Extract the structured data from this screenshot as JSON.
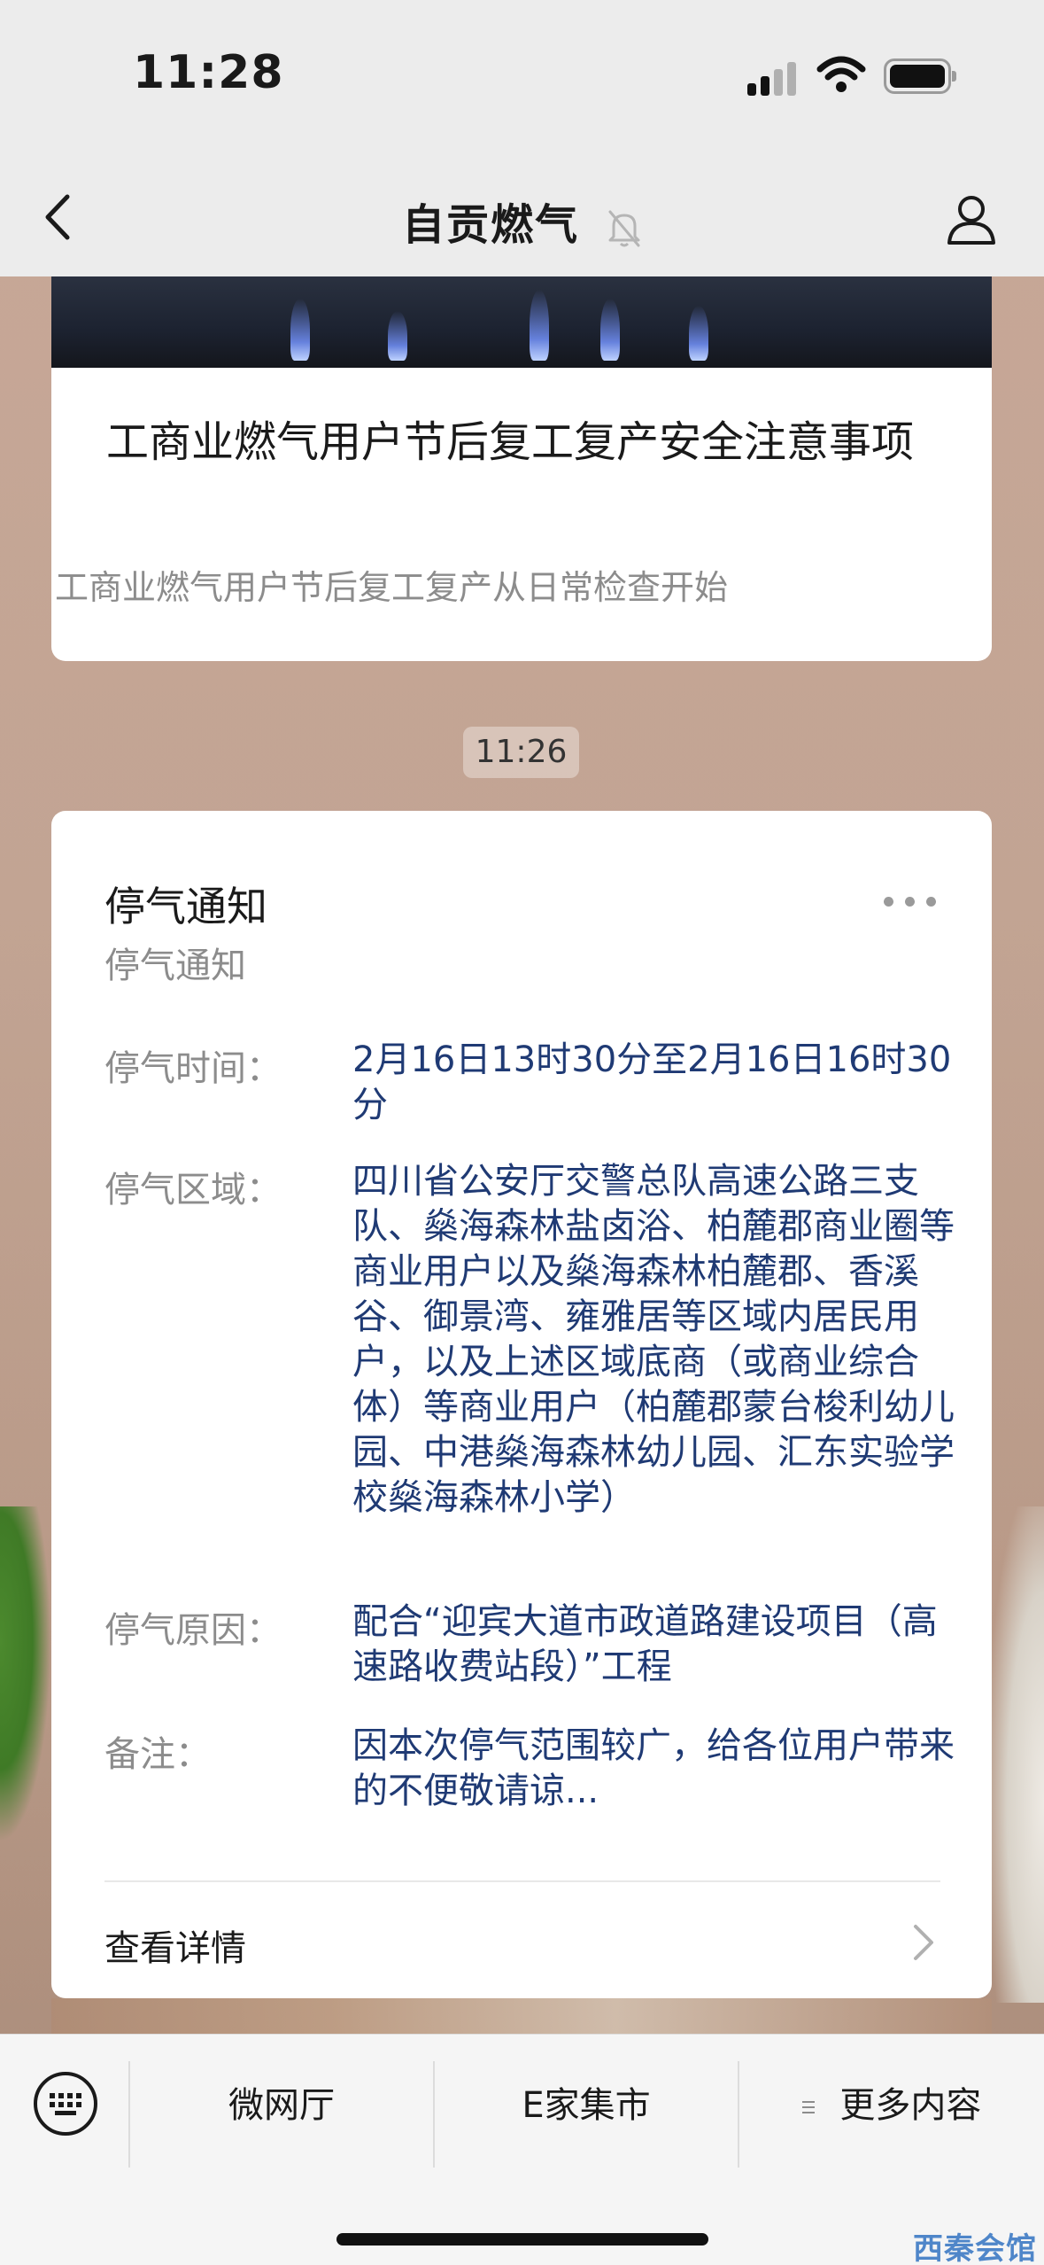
{
  "status_bar": {
    "time": "11:28"
  },
  "nav": {
    "title": "自贡燃气"
  },
  "article": {
    "title": "工商业燃气用户节后复工复产安全注意事项",
    "description": "工商业燃气用户节后复工复产从日常检查开始"
  },
  "message_time": "11:26",
  "notice": {
    "title": "停气通知",
    "subtitle": "停气通知",
    "fields": [
      {
        "label": "停气时间：",
        "value": "2月16日13时30分至2月16日16时30分"
      },
      {
        "label": "停气区域：",
        "value": "四川省公安厅交警总队高速公路三支队、燊海森林盐卤浴、柏麓郡商业圈等商业用户以及燊海森林柏麓郡、香溪谷、御景湾、雍雅居等区域内居民用户，以及上述区域底商（或商业综合体）等商业用户（柏麓郡蒙台梭利幼儿园、中港燊海森林幼儿园、汇东实验学校燊海森林小学）"
      },
      {
        "label": "停气原因：",
        "value": "配合“迎宾大道市政道路建设项目（高速路收费站段）”工程"
      },
      {
        "label": "备注：",
        "value": "因本次停气范围较广，给各位用户带来的不便敬请谅..."
      }
    ],
    "detail_link": "查看详情"
  },
  "bottom_menu": {
    "items": [
      {
        "label": "微网厅"
      },
      {
        "label": "E家集市"
      },
      {
        "label": "更多内容"
      }
    ]
  },
  "watermark": "西秦会馆",
  "icons": {
    "back": "chevron-left-icon",
    "mute": "bell-slash-icon",
    "profile": "person-icon",
    "more": "ellipsis-icon",
    "detail": "chevron-right-icon",
    "keyboard": "keyboard-icon",
    "menu": "hamburger-icon"
  },
  "colors": {
    "link_text": "#1f3a74",
    "secondary_text": "#8c8c8c",
    "background": "#c2a493"
  }
}
